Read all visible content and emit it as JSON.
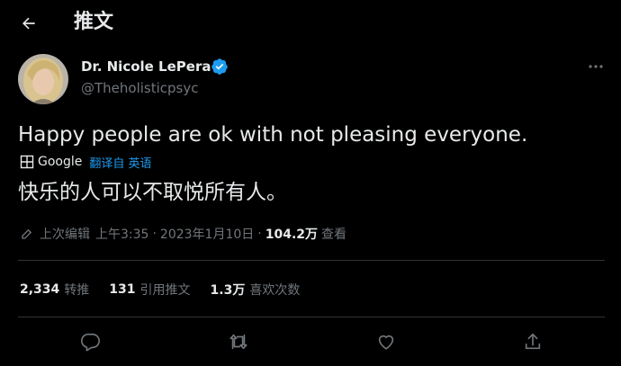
{
  "header": {
    "title": "推文"
  },
  "author": {
    "name": "Dr. Nicole LePera",
    "handle": "@Theholisticpsyc"
  },
  "tweet": {
    "text": "Happy people are ok with not pleasing everyone.",
    "translate": {
      "provider": "Google",
      "label": "翻译自 英语"
    },
    "translated_text": "快乐的人可以不取悦所有人。"
  },
  "meta": {
    "edited_label": "上次编辑",
    "time": "上午3:35",
    "separator": "·",
    "date": "2023年1月10日",
    "views_count": "104.2万",
    "views_label": "查看"
  },
  "stats": {
    "retweets": {
      "count": "2,334",
      "label": "转推"
    },
    "quotes": {
      "count": "131",
      "label": "引用推文"
    },
    "likes": {
      "count": "1.3万",
      "label": "喜欢次数"
    }
  },
  "colors": {
    "background": "#000000",
    "text": "#e7e9ea",
    "secondary": "#71767b",
    "accent": "#1d9bf0",
    "divider": "#2f3336"
  },
  "icons": [
    "back-arrow-icon",
    "verified-badge-icon",
    "more-icon",
    "google-g-icon",
    "edit-icon",
    "reply-icon",
    "retweet-icon",
    "like-icon",
    "share-icon"
  ]
}
